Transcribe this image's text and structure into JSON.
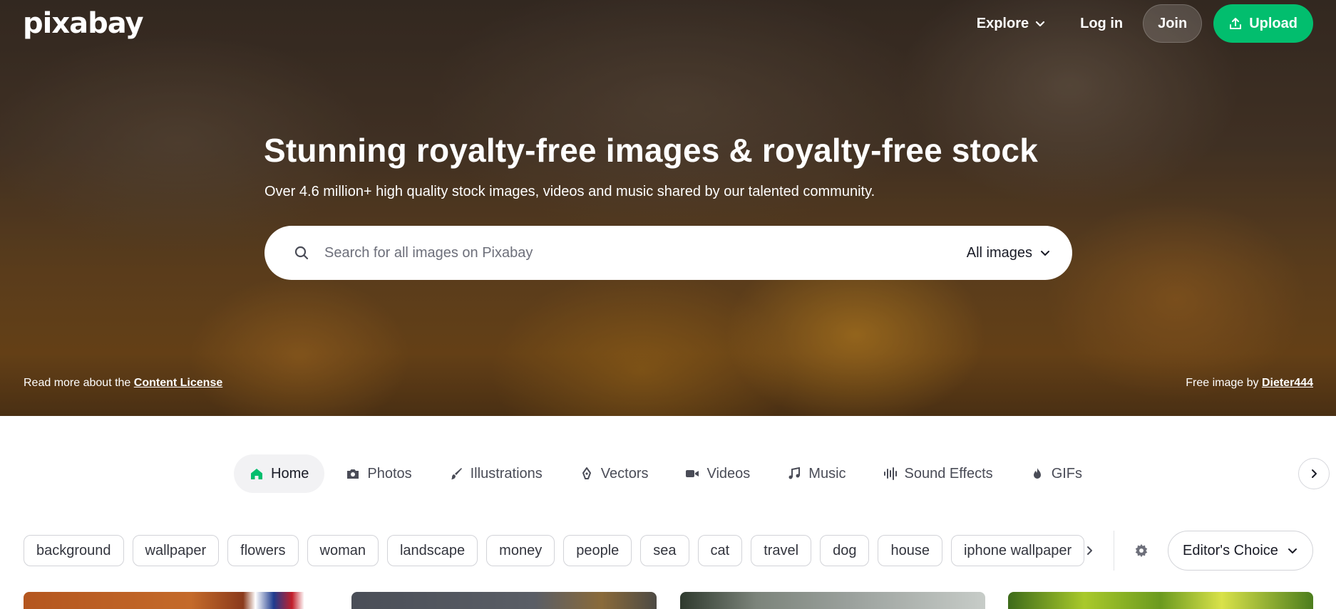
{
  "brand": {
    "logo_text": "pixabay",
    "accent_color": "#02be6e"
  },
  "topnav": {
    "explore_label": "Explore",
    "login_label": "Log in",
    "join_label": "Join",
    "upload_label": "Upload"
  },
  "hero": {
    "title": "Stunning royalty-free images & royalty-free stock",
    "subtitle": "Over 4.6 million+ high quality stock images, videos and music shared by our talented community.",
    "credit_left_prefix": "Read more about the",
    "credit_left_link": "Content License",
    "credit_right_prefix": "Free image by",
    "credit_right_link": "Dieter444"
  },
  "search": {
    "placeholder": "Search for all images on Pixabay",
    "value": "",
    "type_selected": "All images"
  },
  "tabs": [
    {
      "label": "Home",
      "icon": "home-icon",
      "active": true
    },
    {
      "label": "Photos",
      "icon": "camera-icon",
      "active": false
    },
    {
      "label": "Illustrations",
      "icon": "brush-icon",
      "active": false
    },
    {
      "label": "Vectors",
      "icon": "pen-nib-icon",
      "active": false
    },
    {
      "label": "Videos",
      "icon": "video-camera-icon",
      "active": false
    },
    {
      "label": "Music",
      "icon": "music-note-icon",
      "active": false
    },
    {
      "label": "Sound Effects",
      "icon": "sound-wave-icon",
      "active": false
    },
    {
      "label": "GIFs",
      "icon": "flame-icon",
      "active": false
    }
  ],
  "tags": [
    "background",
    "wallpaper",
    "flowers",
    "woman",
    "landscape",
    "money",
    "people",
    "sea",
    "cat",
    "travel",
    "dog",
    "house",
    "iphone wallpaper"
  ],
  "sort": {
    "selected": "Editor's Choice"
  }
}
